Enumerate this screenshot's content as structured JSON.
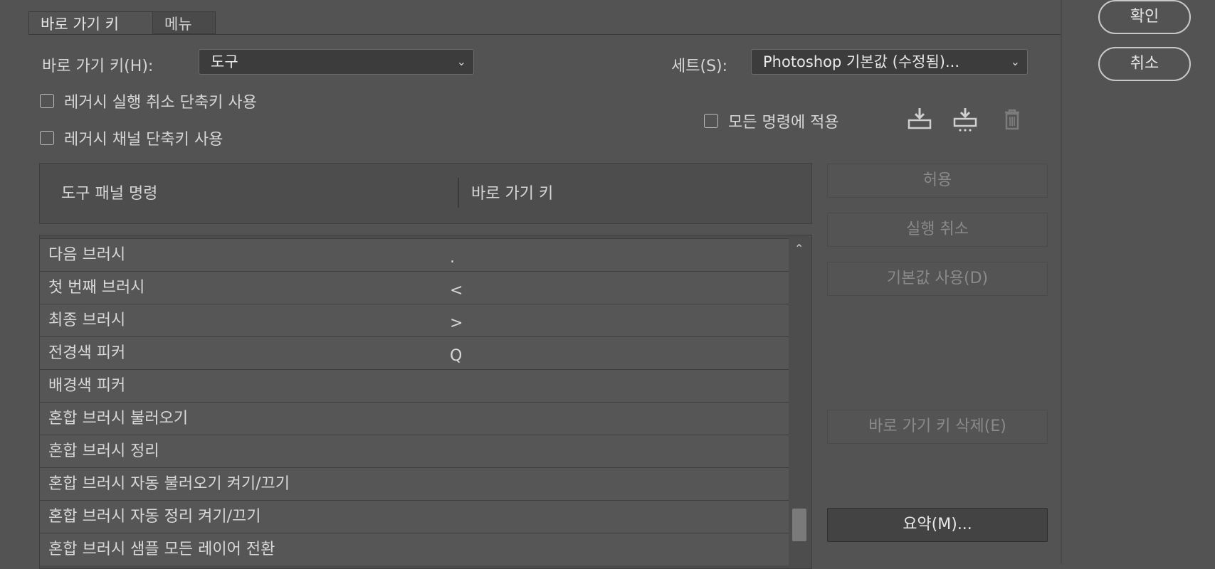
{
  "tabs": [
    {
      "label": "바로 가기 키",
      "active": true
    },
    {
      "label": "메뉴",
      "active": false
    }
  ],
  "shortcuts_for": {
    "label": "바로 가기 키(H):",
    "value": "도구"
  },
  "set": {
    "label": "세트(S):",
    "value": "Photoshop 기본값 (수정됨)..."
  },
  "options": {
    "legacy_undo": "레거시 실행 취소 단축키 사용",
    "legacy_channel": "레거시 채널 단축키 사용",
    "apply_all": "모든 명령에 적용"
  },
  "icons": {
    "save_set": "save-set-icon",
    "save_set_copy": "save-set-copy-icon",
    "delete_set": "trash-icon"
  },
  "columns": {
    "command": "도구 패널 명령",
    "shortcut": "바로 가기 키"
  },
  "rows": [
    {
      "name": "다음 브러시",
      "key": "."
    },
    {
      "name": "첫 번째 브러시",
      "key": "<"
    },
    {
      "name": "최종 브러시",
      "key": ">"
    },
    {
      "name": "전경색 피커",
      "key": "Q"
    },
    {
      "name": "배경색 피커",
      "key": ""
    },
    {
      "name": "혼합 브러시 불러오기",
      "key": ""
    },
    {
      "name": "혼합 브러시 정리",
      "key": ""
    },
    {
      "name": "혼합 브러시 자동 불러오기 켜기/끄기",
      "key": ""
    },
    {
      "name": "혼합 브러시 자동 정리 켜기/끄기",
      "key": ""
    },
    {
      "name": "혼합 브러시 샘플 모든 레이어 전환",
      "key": ""
    }
  ],
  "side_buttons": {
    "accept": "허용",
    "undo": "실행 취소",
    "use_default": "기본값 사용(D)",
    "delete_shortcut": "바로 가기 키 삭제(E)",
    "summarize": "요약(M)..."
  },
  "dialog": {
    "ok": "확인",
    "cancel": "취소"
  }
}
